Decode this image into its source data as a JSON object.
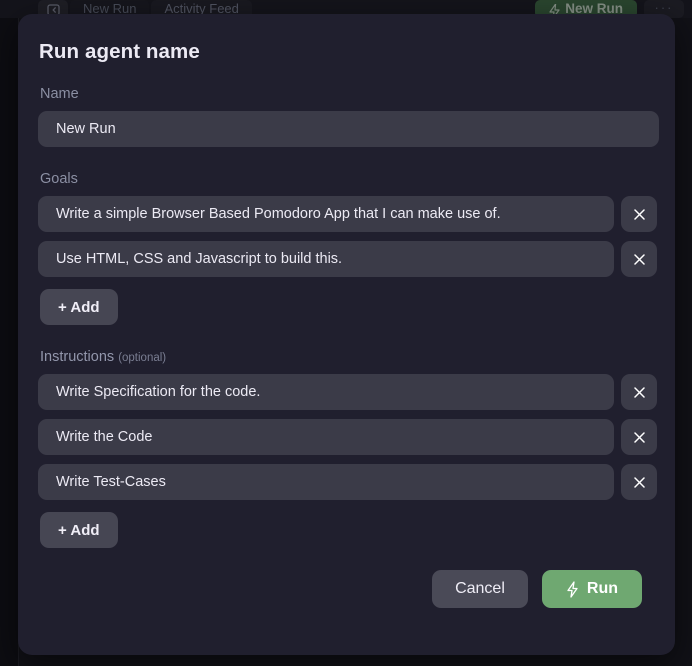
{
  "background": {
    "tab_icon_name": "panel-toggle-icon",
    "tabs": [
      {
        "label": "New Run",
        "active": false
      },
      {
        "label": "Activity Feed",
        "active": true
      }
    ],
    "new_run_button": {
      "label": "New Run",
      "icon": "lightning-bolt-icon",
      "color": "#3e6b44"
    },
    "kebab_label": "···"
  },
  "modal": {
    "title": "Run agent name",
    "name": {
      "label": "Name",
      "value": "New Run",
      "placeholder": "Name"
    },
    "goals": {
      "label": "Goals",
      "items": [
        "Write a simple Browser Based Pomodoro App that I can make use of.",
        "Use HTML, CSS and Javascript to build this."
      ],
      "add_label": "+ Add",
      "remove_icon": "close-icon"
    },
    "instructions": {
      "label": "Instructions",
      "optional_note": "(optional)",
      "items": [
        "Write Specification for the code.",
        "Write the Code",
        "Write Test-Cases"
      ],
      "add_label": "+ Add",
      "remove_icon": "close-icon"
    },
    "footer": {
      "cancel_label": "Cancel",
      "run_label": "Run",
      "run_icon": "lightning-bolt-icon",
      "run_color": "#6fa871"
    }
  }
}
